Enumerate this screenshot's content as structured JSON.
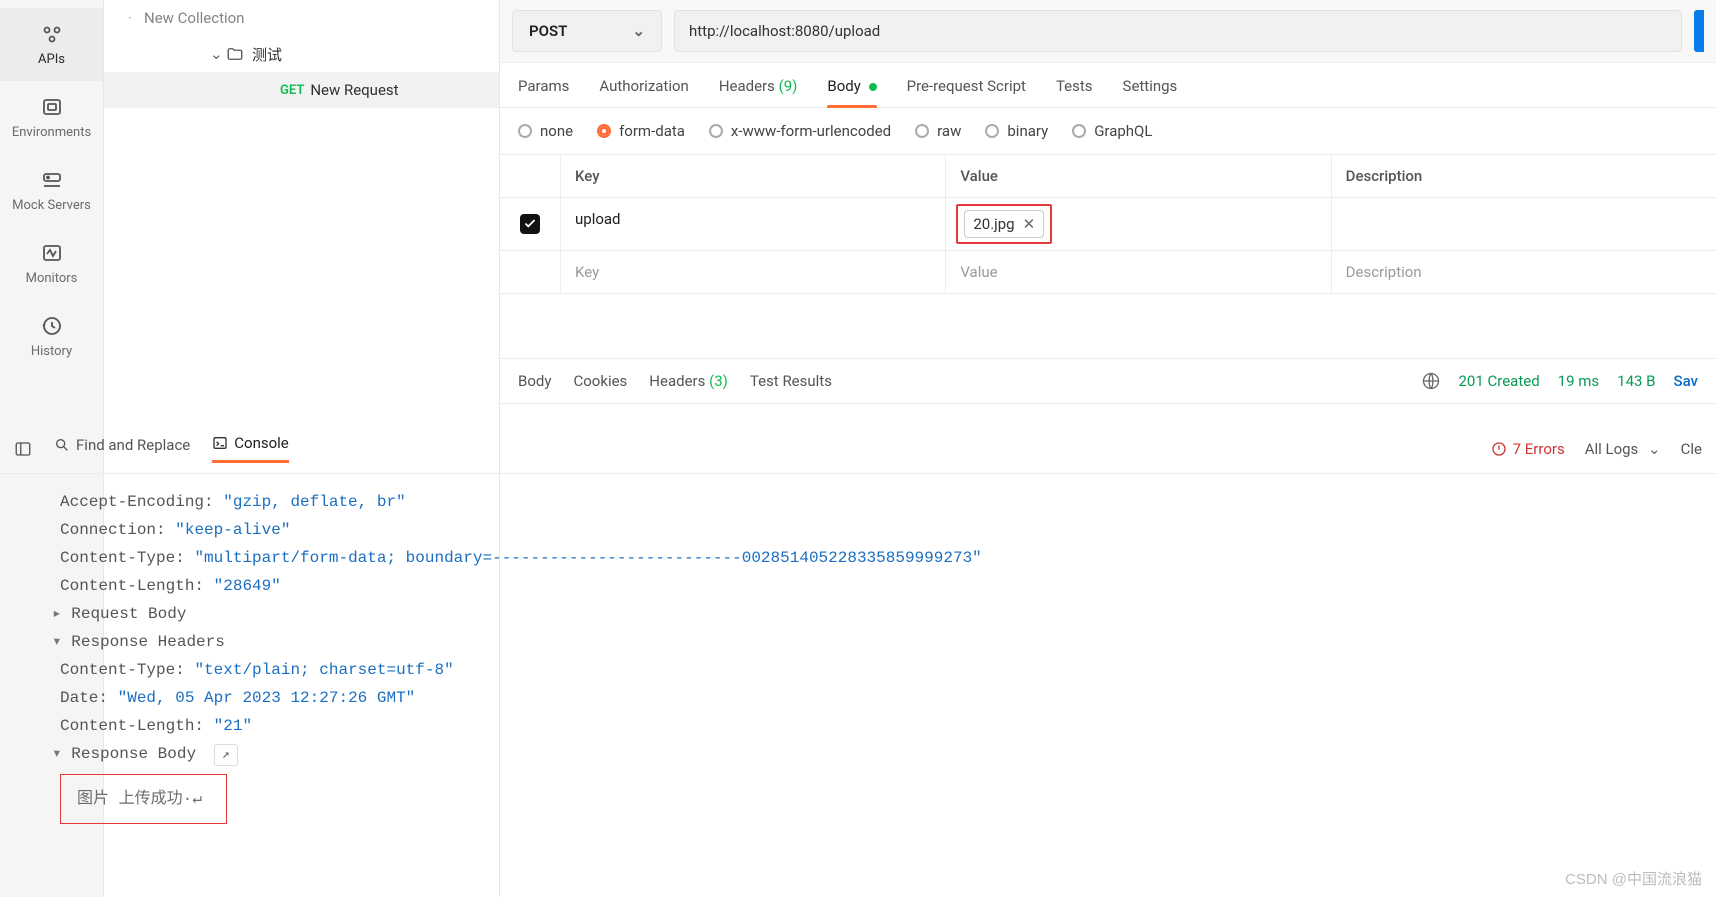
{
  "leftbar": {
    "items": [
      {
        "label": "APIs",
        "icon": "apis"
      },
      {
        "label": "Environments",
        "icon": "env"
      },
      {
        "label": "Mock Servers",
        "icon": "mock"
      },
      {
        "label": "Monitors",
        "icon": "monitor"
      },
      {
        "label": "History",
        "icon": "history"
      }
    ]
  },
  "tree": {
    "row1_label": "New Collection",
    "row2_label": "测试",
    "row3_method": "GET",
    "row3_label": "New Request"
  },
  "request": {
    "method": "POST",
    "url": "http://localhost:8080/upload",
    "tabs": {
      "params": "Params",
      "auth": "Authorization",
      "headers": "Headers",
      "headers_count": "(9)",
      "body": "Body",
      "prerequest": "Pre-request Script",
      "tests": "Tests",
      "settings": "Settings"
    },
    "body_types": {
      "none": "none",
      "formdata": "form-data",
      "xwww": "x-www-form-urlencoded",
      "raw": "raw",
      "binary": "binary",
      "graphql": "GraphQL"
    },
    "formdata": {
      "head_key": "Key",
      "head_value": "Value",
      "head_desc": "Description",
      "rows": [
        {
          "key": "upload",
          "file": "20.jpg"
        }
      ],
      "placeholder_key": "Key",
      "placeholder_value": "Value",
      "placeholder_desc": "Description"
    }
  },
  "response": {
    "tabs": {
      "body": "Body",
      "cookies": "Cookies",
      "headers": "Headers",
      "headers_count": "(3)",
      "tests": "Test Results"
    },
    "status": "201 Created",
    "time": "19 ms",
    "size": "143 B",
    "save": "Sav"
  },
  "footer": {
    "find": "Find and Replace",
    "console": "Console",
    "errors_count": "7 Errors",
    "logs_label": "All Logs",
    "clear": "Cle"
  },
  "console": {
    "req_headers": [
      {
        "k": "Accept-Encoding:",
        "v": "\"gzip, deflate, br\""
      },
      {
        "k": "Connection:",
        "v": "\"keep-alive\""
      },
      {
        "k": "Content-Type:",
        "v": "\"multipart/form-data; boundary=--------------------------002851405228335859999273\""
      },
      {
        "k": "Content-Length:",
        "v": "\"28649\""
      }
    ],
    "request_body_label": "Request Body",
    "response_headers_label": "Response Headers",
    "resp_headers": [
      {
        "k": "Content-Type:",
        "v": "\"text/plain; charset=utf-8\""
      },
      {
        "k": "Date:",
        "v": "\"Wed, 05 Apr 2023 12:27:26 GMT\""
      },
      {
        "k": "Content-Length:",
        "v": "\"21\""
      }
    ],
    "response_body_label": "Response Body",
    "response_body_text": "图片 上传成功·↵"
  },
  "watermark": "CSDN @中国流浪猫"
}
